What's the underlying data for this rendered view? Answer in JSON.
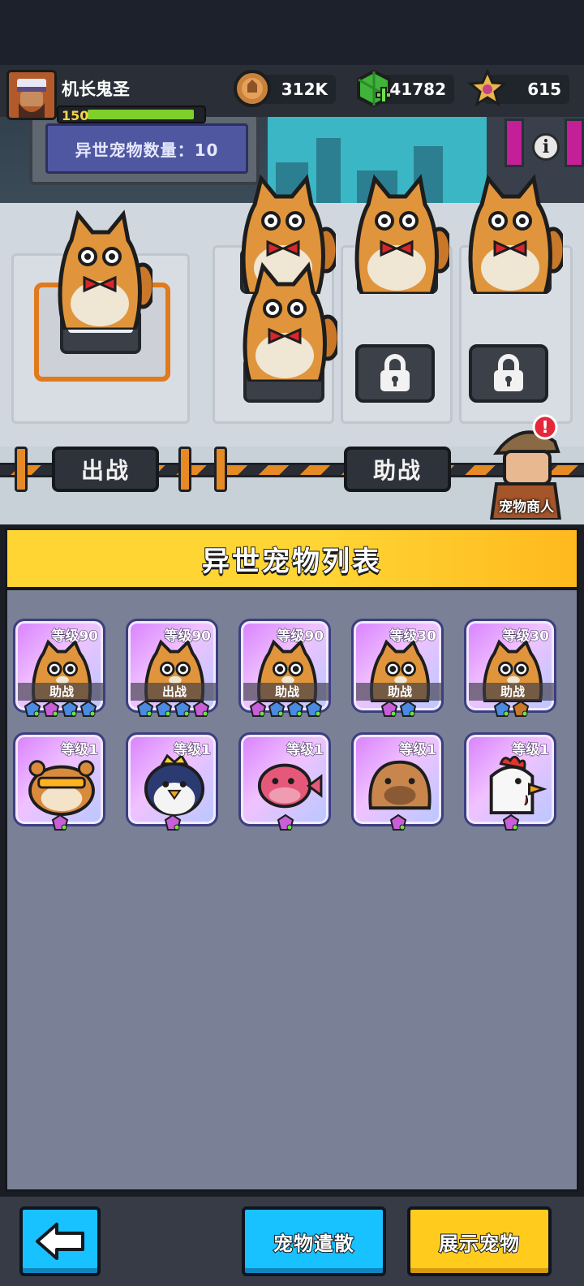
{
  "header": {
    "player_name": "机长鬼圣",
    "player_level": "150",
    "level_progress": 0.95,
    "resources": [
      {
        "icon": "coin-icon",
        "value": "312K"
      },
      {
        "icon": "green-gem-icon",
        "value": "41782"
      },
      {
        "icon": "star-icon",
        "value": "615"
      }
    ]
  },
  "scene": {
    "pet_count_label": "异世宠物数量：10",
    "battle_label": "出战",
    "assist_label": "助战",
    "merchant_label": "宠物商人",
    "info_icon": "i"
  },
  "panel": {
    "title": "异世宠物列表",
    "pets": [
      {
        "level": "等级90",
        "species": "cat",
        "status": "助战"
      },
      {
        "level": "等级90",
        "species": "cat",
        "status": "出战"
      },
      {
        "level": "等级90",
        "species": "cat",
        "status": "助战"
      },
      {
        "level": "等级30",
        "species": "cat",
        "status": "助战"
      },
      {
        "level": "等级30",
        "species": "cat",
        "status": "助战"
      },
      {
        "level": "等级1",
        "species": "hamster",
        "status": ""
      },
      {
        "level": "等级1",
        "species": "penguin",
        "status": ""
      },
      {
        "level": "等级1",
        "species": "pufferfish",
        "status": ""
      },
      {
        "level": "等级1",
        "species": "capybara",
        "status": ""
      },
      {
        "level": "等级1",
        "species": "chicken",
        "status": ""
      }
    ]
  },
  "bottom": {
    "back_icon": "back-arrow-icon",
    "release_label": "宠物遣散",
    "showcase_label": "展示宠物"
  },
  "colors": {
    "accent_yellow": "#ffd534",
    "button_blue": "#18c1ff",
    "button_yellow": "#ffcc1e",
    "card_purple": "#d880ff",
    "panel_bg": "#7a8196"
  }
}
